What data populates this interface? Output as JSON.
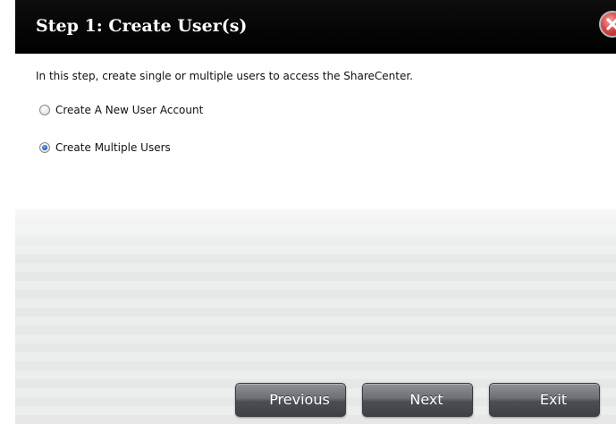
{
  "dialog": {
    "title": "Step 1: Create User(s)",
    "intro": "In this step, create single or multiple users to access the ShareCenter.",
    "options": [
      {
        "label": "Create A New User Account",
        "checked": false
      },
      {
        "label": "Create Multiple Users",
        "checked": true
      }
    ],
    "buttons": {
      "previous": "Previous",
      "next": "Next",
      "exit": "Exit"
    },
    "colors": {
      "titlebar": "#000000",
      "close_icon": "#d64848",
      "button": "#5a5e63"
    },
    "icons": {
      "close": "close-icon"
    }
  }
}
